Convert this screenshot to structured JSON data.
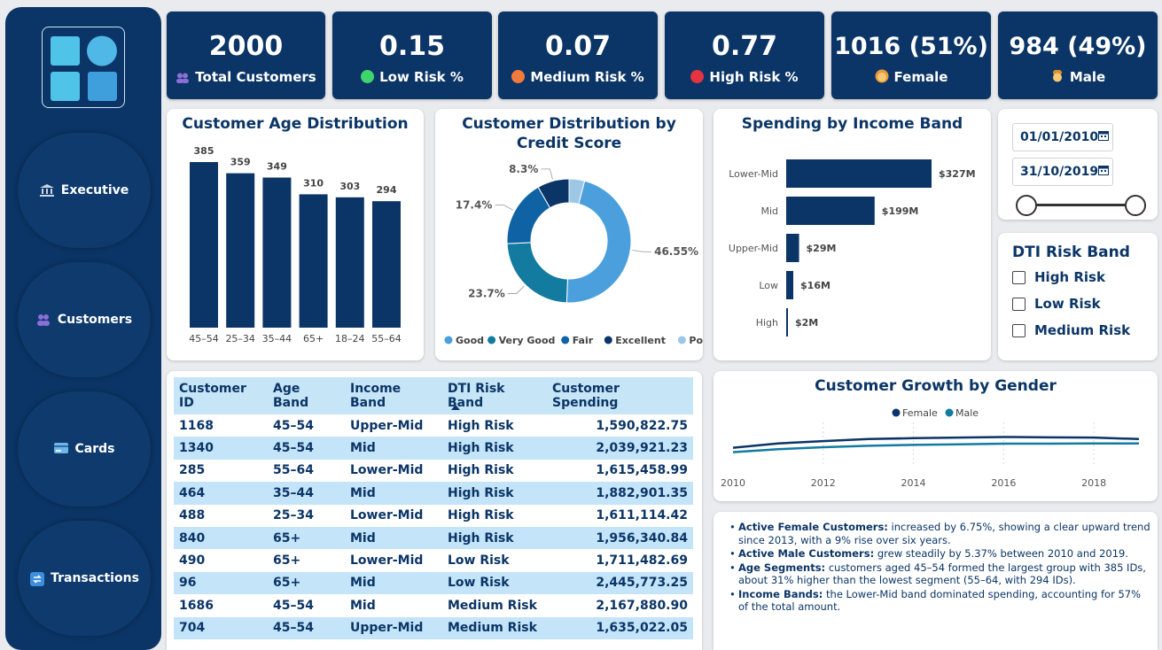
{
  "nav": {
    "items": [
      {
        "label": "Executive",
        "icon": "bank-icon"
      },
      {
        "label": "Customers",
        "icon": "users-icon"
      },
      {
        "label": "Cards",
        "icon": "credit-card-icon"
      },
      {
        "label": "Transactions",
        "icon": "transactions-icon"
      }
    ]
  },
  "kpis": {
    "total": {
      "value": "2000",
      "label": "Total Customers"
    },
    "low": {
      "value": "0.15",
      "label": "Low Risk %",
      "color": "#3fd56a"
    },
    "medium": {
      "value": "0.07",
      "label": "Medium Risk %",
      "color": "#f47a3b"
    },
    "high": {
      "value": "0.77",
      "label": "High Risk %",
      "color": "#e53342"
    },
    "female": {
      "value": "1016 (51%)",
      "label": "Female"
    },
    "male": {
      "value": "984 (49%)",
      "label": "Male"
    }
  },
  "colors": {
    "navy": "#0b3566",
    "good": "#4a9fdc",
    "very_good": "#127b9f",
    "fair": "#0f63a4",
    "excellent": "#0b3566",
    "poor": "#9cc7e7"
  },
  "chart_data": [
    {
      "type": "bar",
      "title": "Customer Age Distribution",
      "categories": [
        "45–54",
        "25–34",
        "35–44",
        "65+",
        "18–24",
        "55–64"
      ],
      "values": [
        385,
        359,
        349,
        310,
        303,
        294
      ],
      "ylim": [
        0,
        400
      ]
    },
    {
      "type": "pie",
      "title": "Customer Distribution by Credit Score",
      "labels": [
        "Good",
        "Very Good",
        "Fair",
        "Excellent",
        "Poor"
      ],
      "values": [
        46.55,
        23.7,
        17.4,
        8.3,
        4.05
      ],
      "data_labels": [
        "46.55%",
        "23.7%",
        "17.4%",
        "8.3%",
        ""
      ],
      "legend": "bottom"
    },
    {
      "type": "bar",
      "orientation": "horizontal",
      "title": "Spending by Income Band",
      "categories": [
        "Lower-Mid",
        "Mid",
        "Upper-Mid",
        "Low",
        "High"
      ],
      "values": [
        327,
        199,
        29,
        16,
        2
      ],
      "data_labels": [
        "$327M",
        "$199M",
        "$29M",
        "$16M",
        "$2M"
      ]
    },
    {
      "type": "line",
      "title": "Customer Growth by Gender",
      "x": [
        2010,
        2011,
        2012,
        2013,
        2014,
        2015,
        2016,
        2017,
        2018,
        2019
      ],
      "x_ticks": [
        "2010",
        "2012",
        "2014",
        "2016",
        "2018"
      ],
      "series": [
        {
          "name": "Female",
          "values": [
            445,
            460,
            468,
            475,
            478,
            480,
            482,
            481,
            480,
            475
          ]
        },
        {
          "name": "Male",
          "values": [
            430,
            440,
            447,
            452,
            455,
            457,
            459,
            459,
            460,
            460
          ]
        }
      ],
      "legend": "top"
    }
  ],
  "dates": {
    "start": "01/01/2010",
    "end": "31/10/2019"
  },
  "dti": {
    "title": "DTI Risk Band",
    "options": [
      "High Risk",
      "Low Risk",
      "Medium Risk"
    ]
  },
  "table": {
    "columns": [
      "Customer ID",
      "Age Band",
      "Income Band",
      "DTI Risk Band",
      "Customer Spending"
    ],
    "rows": [
      [
        "1168",
        "45–54",
        "Upper-Mid",
        "High Risk",
        "1,590,822.75"
      ],
      [
        "1340",
        "45–54",
        "Mid",
        "High Risk",
        "2,039,921.23"
      ],
      [
        "285",
        "55–64",
        "Lower-Mid",
        "High Risk",
        "1,615,458.99"
      ],
      [
        "464",
        "35–44",
        "Mid",
        "High Risk",
        "1,882,901.35"
      ],
      [
        "488",
        "25–34",
        "Lower-Mid",
        "High Risk",
        "1,611,114.42"
      ],
      [
        "840",
        "65+",
        "Mid",
        "High Risk",
        "1,956,340.84"
      ],
      [
        "490",
        "65+",
        "Lower-Mid",
        "Low Risk",
        "1,711,482.69"
      ],
      [
        "96",
        "65+",
        "Mid",
        "Low Risk",
        "2,445,773.25"
      ],
      [
        "1686",
        "45–54",
        "Mid",
        "Medium Risk",
        "2,167,880.90"
      ],
      [
        "704",
        "45–54",
        "Upper-Mid",
        "Medium Risk",
        "1,635,022.05"
      ]
    ]
  },
  "insights": [
    {
      "head": "Active Female Customers:",
      "text": " increased by 6.75%, showing a clear upward trend since 2013, with a 9% rise over six years."
    },
    {
      "head": "Active Male Customers:",
      "text": " grew steadily by 5.37% between 2010 and 2019."
    },
    {
      "head": "Age Segments:",
      "text": " customers aged 45–54 formed the largest group with 385 IDs, about 31% higher than the lowest segment (55–64, with 294 IDs)."
    },
    {
      "head": "Income Bands:",
      "text": " the Lower-Mid band dominated spending, accounting for 57% of the total amount."
    }
  ]
}
